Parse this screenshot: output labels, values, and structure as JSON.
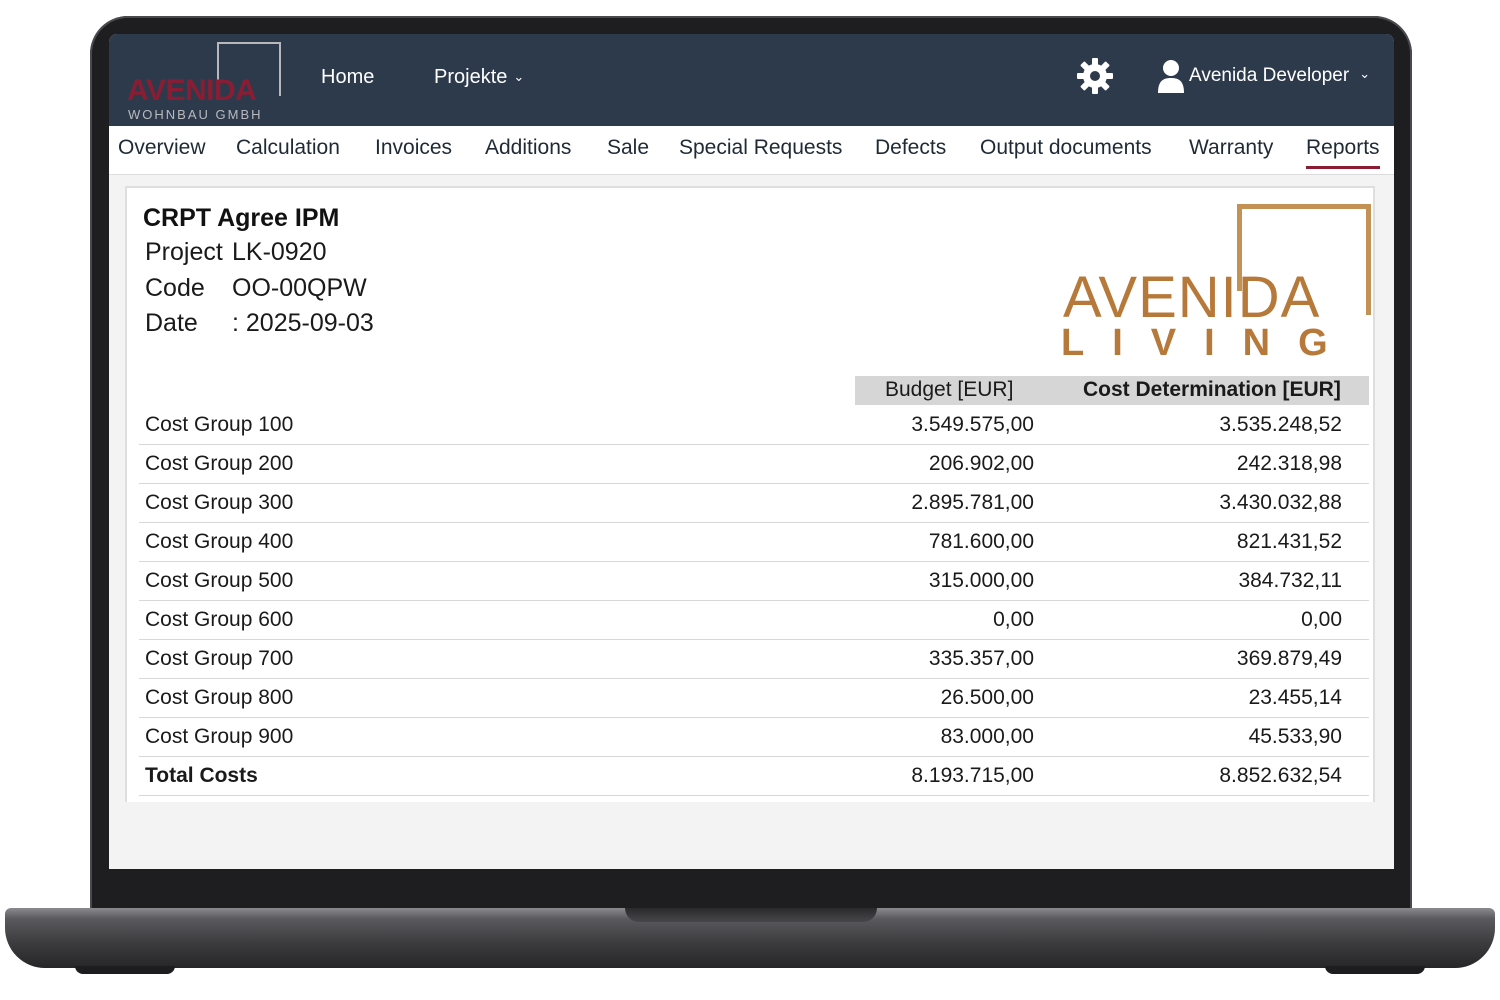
{
  "brand": {
    "logo_word": "AVENIDA",
    "logo_sub": "WOHNBAU GMBH",
    "accent_color": "#8a1d33",
    "navbar_color": "#2d3a4c"
  },
  "nav": {
    "home": "Home",
    "projekte": "Projekte",
    "settings_icon": "gear-icon",
    "user_icon": "user-icon",
    "user_name": "Avenida Developer"
  },
  "tabs": [
    {
      "label": "Overview"
    },
    {
      "label": "Calculation"
    },
    {
      "label": "Invoices"
    },
    {
      "label": "Additions"
    },
    {
      "label": "Sale"
    },
    {
      "label": "Special Requests"
    },
    {
      "label": "Defects"
    },
    {
      "label": "Output documents"
    },
    {
      "label": "Warranty"
    },
    {
      "label": "Reports",
      "active": true
    }
  ],
  "report": {
    "title": "CRPT Agree IPM",
    "project_label": "Project",
    "project_value": "LK-0920",
    "code_label": "Code",
    "code_value": "OO-00QPW",
    "date_label": "Date",
    "date_value": ": 2025-09-03",
    "brand_logo_word": "AVENIDA",
    "brand_logo_sub": "LIVING",
    "columns": {
      "budget": "Budget [EUR]",
      "cost": "Cost Determination [EUR]"
    },
    "rows": [
      {
        "label": "Cost Group 100",
        "budget": "3.549.575,00",
        "cost": "3.535.248,52"
      },
      {
        "label": "Cost Group 200",
        "budget": "206.902,00",
        "cost": "242.318,98"
      },
      {
        "label": "Cost Group 300",
        "budget": "2.895.781,00",
        "cost": "3.430.032,88"
      },
      {
        "label": "Cost Group 400",
        "budget": "781.600,00",
        "cost": "821.431,52"
      },
      {
        "label": "Cost Group 500",
        "budget": "315.000,00",
        "cost": "384.732,11"
      },
      {
        "label": "Cost Group 600",
        "budget": "0,00",
        "cost": "0,00"
      },
      {
        "label": "Cost Group 700",
        "budget": "335.357,00",
        "cost": "369.879,49"
      },
      {
        "label": "Cost Group 800",
        "budget": "26.500,00",
        "cost": "23.455,14"
      },
      {
        "label": "Cost Group 900",
        "budget": "83.000,00",
        "cost": "45.533,90"
      },
      {
        "label": "Total Costs",
        "budget": "8.193.715,00",
        "cost": "8.852.632,54"
      }
    ]
  }
}
